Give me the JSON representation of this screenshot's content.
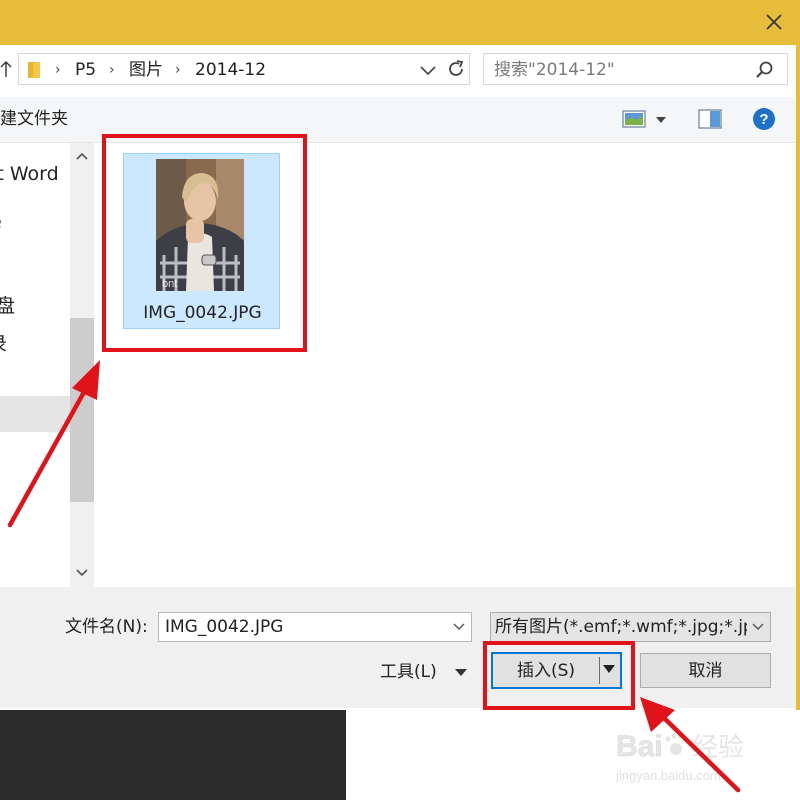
{
  "window": {
    "close_label": "×"
  },
  "address_bar": {
    "crumbs": [
      "P5",
      "图片",
      "2014-12"
    ],
    "separator": "›"
  },
  "search": {
    "placeholder": "搜索\"2014-12\""
  },
  "toolbar": {
    "new_folder_label": "新建文件夹"
  },
  "nav_pane": {
    "items": [
      "ft Word",
      "e",
      "盘",
      "录"
    ]
  },
  "files": [
    {
      "name": "IMG_0042.JPG",
      "selected": true
    }
  ],
  "footer": {
    "file_name_label": "文件名(N):",
    "file_name_value": "IMG_0042.JPG",
    "file_type_value": "所有图片(*.emf;*.wmf;*.jpg;*.jpeg;*.jfif;*.jpe;*.png;*.bmp;*.dib;*.rle;*.gif;*.emz;*.wmz;*.tif;*.tiff;*.svg;*.ico)",
    "tools_label": "工具(L)",
    "insert_label": "插入(S)",
    "cancel_label": "取消"
  },
  "watermark": {
    "brand": "Bai",
    "brand_suffix": "经验",
    "url": "jingyan.baidu.com"
  },
  "colors": {
    "title_bar": "#e6bd3a",
    "selection_fill": "#cce8ff",
    "highlight_red": "#e0121a",
    "accent_blue": "#0078d7"
  }
}
